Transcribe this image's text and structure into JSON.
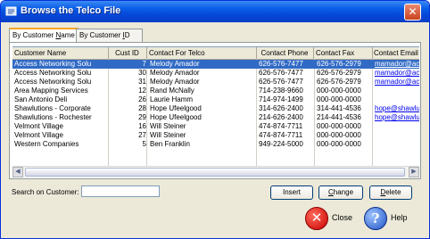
{
  "window": {
    "title": "Browse the Telco File",
    "close_glyph": "✕"
  },
  "tabs": [
    {
      "prefix": "By Customer ",
      "accel": "N",
      "suffix": "ame",
      "active": true
    },
    {
      "prefix": "By Customer ",
      "accel": "I",
      "suffix": "D",
      "active": false
    }
  ],
  "table": {
    "columns": [
      "Customer Name",
      "Cust ID",
      "Contact For Telco",
      "Contact Phone",
      "Contact Fax",
      "Contact Email"
    ],
    "rows": [
      {
        "name": "Access Networking Solu",
        "id": "7",
        "contact": "Melody Amador",
        "phone": "626-576-7477",
        "fax": "626-576-2979",
        "email": "mamador@ac",
        "selected": true
      },
      {
        "name": "Access Networking Solu",
        "id": "30",
        "contact": "Melody Amador",
        "phone": "626-576-7477",
        "fax": "626-576-2979",
        "email": "mamador@ac",
        "selected": false
      },
      {
        "name": "Access Networking Solu",
        "id": "31",
        "contact": "Melody Amador",
        "phone": "626-576-7477",
        "fax": "626-576-2979",
        "email": "mamador@ac",
        "selected": false
      },
      {
        "name": "Area Mapping Services",
        "id": "12",
        "contact": "Rand McNally",
        "phone": "714-238-9660",
        "fax": "000-000-0000",
        "email": "",
        "selected": false
      },
      {
        "name": "San Antonio Deli",
        "id": "26",
        "contact": "Laurie Hamm",
        "phone": "714-974-1499",
        "fax": "000-000-0000",
        "email": "",
        "selected": false
      },
      {
        "name": "Shawlutions - Corporate",
        "id": "28",
        "contact": "Hope Ufeelgood",
        "phone": "314-626-2400",
        "fax": "314-441-4536",
        "email": "hope@shawlu",
        "selected": false
      },
      {
        "name": "Shawlutions - Rochester",
        "id": "29",
        "contact": "Hope Ufeelgood",
        "phone": "214-626-2400",
        "fax": "214-441-4536",
        "email": "hope@shawlu",
        "selected": false
      },
      {
        "name": "Velmont Village",
        "id": "16",
        "contact": "Will Steiner",
        "phone": "474-874-7711",
        "fax": "000-000-0000",
        "email": "",
        "selected": false
      },
      {
        "name": "Velmont Village",
        "id": "27",
        "contact": "Will Steiner",
        "phone": "474-874-7711",
        "fax": "000-000-0000",
        "email": "",
        "selected": false
      },
      {
        "name": "Western Companies",
        "id": "5",
        "contact": "Ben Franklin",
        "phone": "949-224-5000",
        "fax": "000-000-0000",
        "email": "",
        "selected": false
      }
    ]
  },
  "search": {
    "label": "Search on Customer:",
    "value": ""
  },
  "buttons": {
    "insert": {
      "label": "Insert"
    },
    "change": {
      "label": "Change",
      "accel": "C",
      "rest": "hange"
    },
    "delete": {
      "label": "Delete",
      "accel": "D",
      "rest": "elete"
    },
    "close": {
      "label": "Close",
      "icon": "close-x-icon"
    },
    "help": {
      "label": "Help",
      "icon": "help-question-icon"
    }
  },
  "colors": {
    "title_bar": "#0a5ee7",
    "selection": "#316ac5",
    "tab_accent": "#f7a428"
  }
}
